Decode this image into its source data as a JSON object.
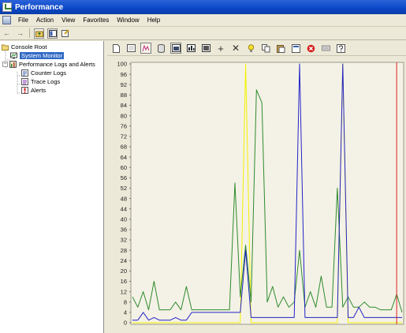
{
  "window": {
    "title": "Performance"
  },
  "menubar": {
    "items": [
      "File",
      "Action",
      "View",
      "Favorites",
      "Window",
      "Help"
    ]
  },
  "toolbar": {
    "icons": [
      "back-arrow-icon",
      "forward-arrow-icon",
      "up-folder-icon",
      "show-hide-tree-icon",
      "properties-icon"
    ]
  },
  "tree": {
    "root": "Console Root",
    "system_monitor": "System Monitor",
    "perf_logs": "Performance Logs and Alerts",
    "counter_logs": "Counter Logs",
    "trace_logs": "Trace Logs",
    "alerts": "Alerts"
  },
  "monitor_toolbar": {
    "icons": [
      "new-counter-set-icon",
      "clear-display-icon",
      "view-current-activity-icon",
      "view-log-data-icon",
      "view-graph-icon",
      "view-histogram-icon",
      "view-report-icon",
      "add-counter-icon",
      "delete-counter-icon",
      "highlight-icon",
      "copy-properties-icon",
      "paste-counter-list-icon",
      "properties-icon",
      "freeze-display-icon",
      "update-data-icon",
      "help-icon"
    ]
  },
  "colors": {
    "green": "#2e8b2e",
    "blue": "#2323c8",
    "yellow": "#f4f200",
    "red": "#e02020",
    "selection": "#316ac5"
  },
  "chart_data": {
    "type": "line",
    "title": "",
    "xlabel": "",
    "ylabel": "",
    "ylim": [
      0,
      100
    ],
    "yticks": [
      0,
      4,
      8,
      12,
      16,
      20,
      24,
      28,
      32,
      36,
      40,
      44,
      48,
      52,
      56,
      60,
      64,
      68,
      72,
      76,
      80,
      84,
      88,
      92,
      96,
      100
    ],
    "x": [
      0,
      1,
      2,
      3,
      4,
      5,
      6,
      7,
      8,
      9,
      10,
      11,
      12,
      13,
      14,
      15,
      16,
      17,
      18,
      19,
      20,
      21,
      22,
      23,
      24,
      25,
      26,
      27,
      28,
      29,
      30,
      31,
      32,
      33,
      34,
      35,
      36,
      37,
      38,
      39,
      40,
      41,
      42,
      43,
      44,
      45,
      46,
      47,
      48,
      49,
      50
    ],
    "series": [
      {
        "color": "green",
        "values": [
          10,
          6,
          12,
          5,
          16,
          5,
          5,
          5,
          8,
          5,
          14,
          5,
          5,
          5,
          5,
          5,
          5,
          5,
          5,
          54,
          10,
          30,
          8,
          90,
          85,
          8,
          14,
          6,
          10,
          6,
          8,
          28,
          6,
          12,
          6,
          18,
          6,
          6,
          52,
          6,
          10,
          6,
          6,
          8,
          6,
          6,
          5,
          5,
          5,
          11,
          4
        ]
      },
      {
        "color": "blue",
        "values": [
          1,
          1,
          4,
          1,
          2,
          1,
          1,
          1,
          2,
          1,
          1,
          4,
          4,
          4,
          4,
          4,
          4,
          4,
          4,
          4,
          4,
          28,
          2,
          2,
          2,
          2,
          2,
          2,
          2,
          2,
          2,
          100,
          2,
          2,
          2,
          2,
          2,
          2,
          2,
          100,
          2,
          2,
          6,
          2,
          2,
          2,
          2,
          2,
          2,
          2,
          2
        ]
      },
      {
        "color": "yellow",
        "values": [
          0,
          0,
          0,
          0,
          0,
          0,
          0,
          0,
          0,
          0,
          0,
          0,
          0,
          0,
          0,
          0,
          0,
          0,
          0,
          0,
          0,
          100,
          0,
          0,
          0,
          0,
          0,
          0,
          0,
          0,
          0,
          0,
          0,
          0,
          0,
          0,
          0,
          0,
          0,
          100,
          0,
          0,
          0,
          0,
          0,
          0,
          0,
          0,
          0,
          0,
          0
        ]
      }
    ],
    "time_bar_position": 49,
    "grid": false,
    "legend": "none"
  }
}
